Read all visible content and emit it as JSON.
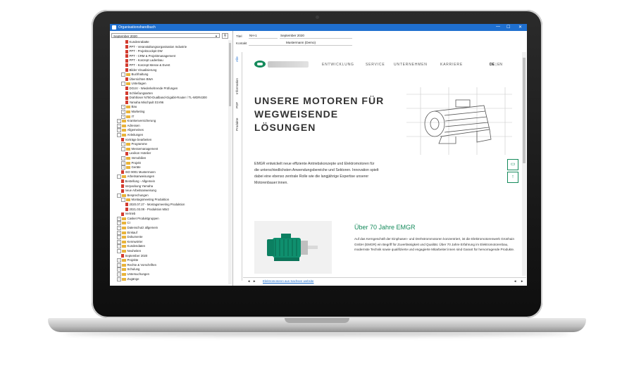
{
  "window": {
    "title": "Organisationshandbuch",
    "min": "—",
    "max": "☐",
    "close": "✕"
  },
  "left": {
    "period_select": "September 2020",
    "tree": [
      {
        "label": "Kundenrabatte",
        "kind": "doc",
        "indent": 3
      },
      {
        "label": "PPT - Veranstaltungsorganisation Industrie",
        "kind": "doc",
        "indent": 3
      },
      {
        "label": "PPT - Projektcockpit DW",
        "kind": "doc",
        "indent": 3
      },
      {
        "label": "PPT - CRM & Projektmanagement",
        "kind": "doc",
        "indent": 3
      },
      {
        "label": "PPT - Konzept Ladenbau",
        "kind": "doc",
        "indent": 3
      },
      {
        "label": "PPT - Konzept Messe & Event",
        "kind": "doc",
        "indent": 3
      },
      {
        "label": "Bilder Visualisierung",
        "kind": "doc",
        "indent": 3
      },
      {
        "label": "Buchhaltung",
        "kind": "folder",
        "indent": 2,
        "toggle": "-"
      },
      {
        "label": "Übersichten BWA",
        "kind": "doc",
        "indent": 3
      },
      {
        "label": "Unterlagen",
        "kind": "folder",
        "indent": 2,
        "toggle": "-"
      },
      {
        "label": "DGUV - Wiederkehrende Prüfungen",
        "kind": "doc",
        "indent": 3
      },
      {
        "label": "Schließungsarten",
        "kind": "doc",
        "indent": 3
      },
      {
        "label": "Drahtloser N750-Dualband-Gigabit-Router / TL-WDR4300",
        "kind": "doc",
        "indent": 3
      },
      {
        "label": "Yamaha Mischpult 01V96",
        "kind": "doc",
        "indent": 3
      },
      {
        "label": "Bau",
        "kind": "folder",
        "indent": 2,
        "toggle": "+"
      },
      {
        "label": "Marketing",
        "kind": "folder",
        "indent": 2,
        "toggle": "+"
      },
      {
        "label": "IT",
        "kind": "folder",
        "indent": 2,
        "toggle": "+"
      },
      {
        "label": "Krankenversicherung",
        "kind": "folder",
        "indent": 1,
        "toggle": "+"
      },
      {
        "label": "Adressen",
        "kind": "folder",
        "indent": 1,
        "toggle": "+"
      },
      {
        "label": "Allgemeines",
        "kind": "folder",
        "indent": 1,
        "toggle": "+"
      },
      {
        "label": "Anleitungen",
        "kind": "folder",
        "indent": 1,
        "toggle": "-"
      },
      {
        "label": "Vorträge bearbeiten",
        "kind": "doc",
        "indent": 2
      },
      {
        "label": "Programme",
        "kind": "folder",
        "indent": 2,
        "toggle": "+"
      },
      {
        "label": "Messemanagement",
        "kind": "folder",
        "indent": 2,
        "toggle": "-"
      },
      {
        "label": "Lexikon Hotelier",
        "kind": "doc",
        "indent": 3
      },
      {
        "label": "Immobilien",
        "kind": "folder",
        "indent": 2,
        "toggle": "+"
      },
      {
        "label": "Projekt",
        "kind": "folder",
        "indent": 2,
        "toggle": "+"
      },
      {
        "label": "Geräte",
        "kind": "folder",
        "indent": 2,
        "toggle": "+"
      },
      {
        "label": "ISO 9001 Mustermann",
        "kind": "doc",
        "indent": 2
      },
      {
        "label": "Arbeitsanweisungen",
        "kind": "folder",
        "indent": 1,
        "toggle": "-"
      },
      {
        "label": "Bestellung - Allgemein",
        "kind": "doc",
        "indent": 2
      },
      {
        "label": "Verpackung Yamaha",
        "kind": "doc",
        "indent": 2
      },
      {
        "label": "neue Arbeitsanweisung",
        "kind": "doc",
        "indent": 2
      },
      {
        "label": "Besprechungen",
        "kind": "folder",
        "indent": 1,
        "toggle": "-"
      },
      {
        "label": "Montagsmeeting Produktion",
        "kind": "folder",
        "indent": 2,
        "toggle": "-"
      },
      {
        "label": "2020.07.27 - Montagsmeeting Produktion",
        "kind": "doc",
        "indent": 3
      },
      {
        "label": "2021.03.08 - Produktion März",
        "kind": "doc",
        "indent": 3
      },
      {
        "label": "Vertrieb",
        "kind": "doc",
        "indent": 2
      },
      {
        "label": "Casket Produktgruppen",
        "kind": "folder",
        "indent": 1,
        "toggle": "+"
      },
      {
        "label": "CI",
        "kind": "folder",
        "indent": 1,
        "toggle": "+"
      },
      {
        "label": "Datenschutz allgemein",
        "kind": "folder",
        "indent": 1,
        "toggle": "+"
      },
      {
        "label": "Einkauf",
        "kind": "folder",
        "indent": 1,
        "toggle": "+"
      },
      {
        "label": "Dokumente",
        "kind": "folder",
        "indent": 1,
        "toggle": "+"
      },
      {
        "label": "Kennwörter",
        "kind": "folder",
        "indent": 1,
        "toggle": "+"
      },
      {
        "label": "Kundendaten",
        "kind": "folder",
        "indent": 1,
        "toggle": "+"
      },
      {
        "label": "Neuheiten",
        "kind": "folder",
        "indent": 1,
        "toggle": "-"
      },
      {
        "label": "September 2020",
        "kind": "doc",
        "indent": 2
      },
      {
        "label": "Projekte",
        "kind": "folder",
        "indent": 1,
        "toggle": "+"
      },
      {
        "label": "Rechte & Vorschriften",
        "kind": "folder",
        "indent": 1,
        "toggle": "+"
      },
      {
        "label": "Schulung",
        "kind": "folder",
        "indent": 1,
        "toggle": "+"
      },
      {
        "label": "Untersuchungen",
        "kind": "folder",
        "indent": 1,
        "toggle": "+"
      },
      {
        "label": "Zugänge",
        "kind": "folder",
        "indent": 1,
        "toggle": "+"
      }
    ]
  },
  "fields": {
    "titel_label": "Titel",
    "titel_value": "NH-1",
    "titel_value2": "September 2020",
    "kontakt_label": "Kontakt",
    "kontakt_value": "Mustermann (Demo)"
  },
  "tabs": [
    "Alle",
    "Information",
    "PDF",
    "Produkte"
  ],
  "website": {
    "nav": [
      "ENTWICKLUNG",
      "SERVICE",
      "UNTERNEHMEN",
      "KARRIERE"
    ],
    "lang_de": "DE",
    "lang_sep": "|",
    "lang_en": "EN",
    "headline": "UNSERE MOTOREN FÜR WEGWEISENDE LÖSUNGEN",
    "intro": "EMGR entwickelt neue effiziente Antriebskonzepte und Elektromotoren für die unterschiedlichsten Anwendungsbereiche und Sektoren. Innovation spielt dabei eine ebenso zentrale Rolle wie die langjährige Expertise unserer Motorenbauer:innen.",
    "section_title": "Über 70 Jahre EMGR",
    "section_text": "Auf das Kerngeschäft der Einphasen- und Drehstrommotoren konzentriert, ist die Elektromotorenwerk Grünhain GmbH (EMGR) ein Begriff für Zuverlässigkeit und Qualität. Über 70 Jahre Erfahrung im Elektromotorenbau, modernste Technik sowie qualifizierte und engagierte Mitarbeiter:innen sind Garant für hervorragende Produkte.",
    "chat_icon": "chat-icon",
    "up_icon": "arrow-up-icon"
  },
  "bottom": {
    "link": "Elektromotoren aus Sachsen website"
  },
  "colors": {
    "titlebar": "#1f6fcf",
    "brand_green": "#148a5b",
    "folder": "#e8b33a",
    "doc": "#d23b2f"
  }
}
